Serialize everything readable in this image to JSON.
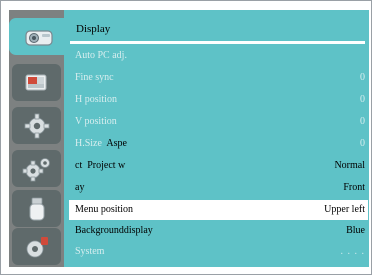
{
  "panel": {
    "title": "Display"
  },
  "rail": {
    "tabs": [
      {
        "name": "tab-display",
        "icon": "display-icon",
        "active": true
      },
      {
        "name": "tab-image",
        "icon": "image-icon",
        "active": false
      },
      {
        "name": "tab-setting",
        "icon": "gear-icon",
        "active": false
      },
      {
        "name": "tab-expand",
        "icon": "gears-icon",
        "active": false
      },
      {
        "name": "tab-network",
        "icon": "usb-icon",
        "active": false
      },
      {
        "name": "tab-info",
        "icon": "info-icon",
        "active": false
      }
    ]
  },
  "menu": {
    "auto_pc": {
      "label": "Auto PC adj.",
      "value": ""
    },
    "fine_sync": {
      "label": "Fine sync",
      "value": "0"
    },
    "h_position": {
      "label": "H position",
      "value": "0"
    },
    "v_position": {
      "label": "V position",
      "value": "0"
    },
    "h_size": {
      "label": "H.Size",
      "label_bold": "Aspe",
      "value": "0"
    },
    "aspect_project": {
      "label": "ct  Project w",
      "value": "Normal"
    },
    "display": {
      "label": "ay",
      "value": "Front"
    },
    "menu_position": {
      "label": "Menu position",
      "value": "Upper left"
    },
    "background_display": {
      "label": "Backgrounddisplay",
      "value": "Blue"
    },
    "system": {
      "label": "System",
      "value": ". . . ."
    }
  },
  "colors": {
    "accent": "#5ec2c7",
    "rail": "#7d8181",
    "tab": "#5f6a6b",
    "dim_text": "#d8eeef",
    "selected_row": "#ffffff"
  }
}
